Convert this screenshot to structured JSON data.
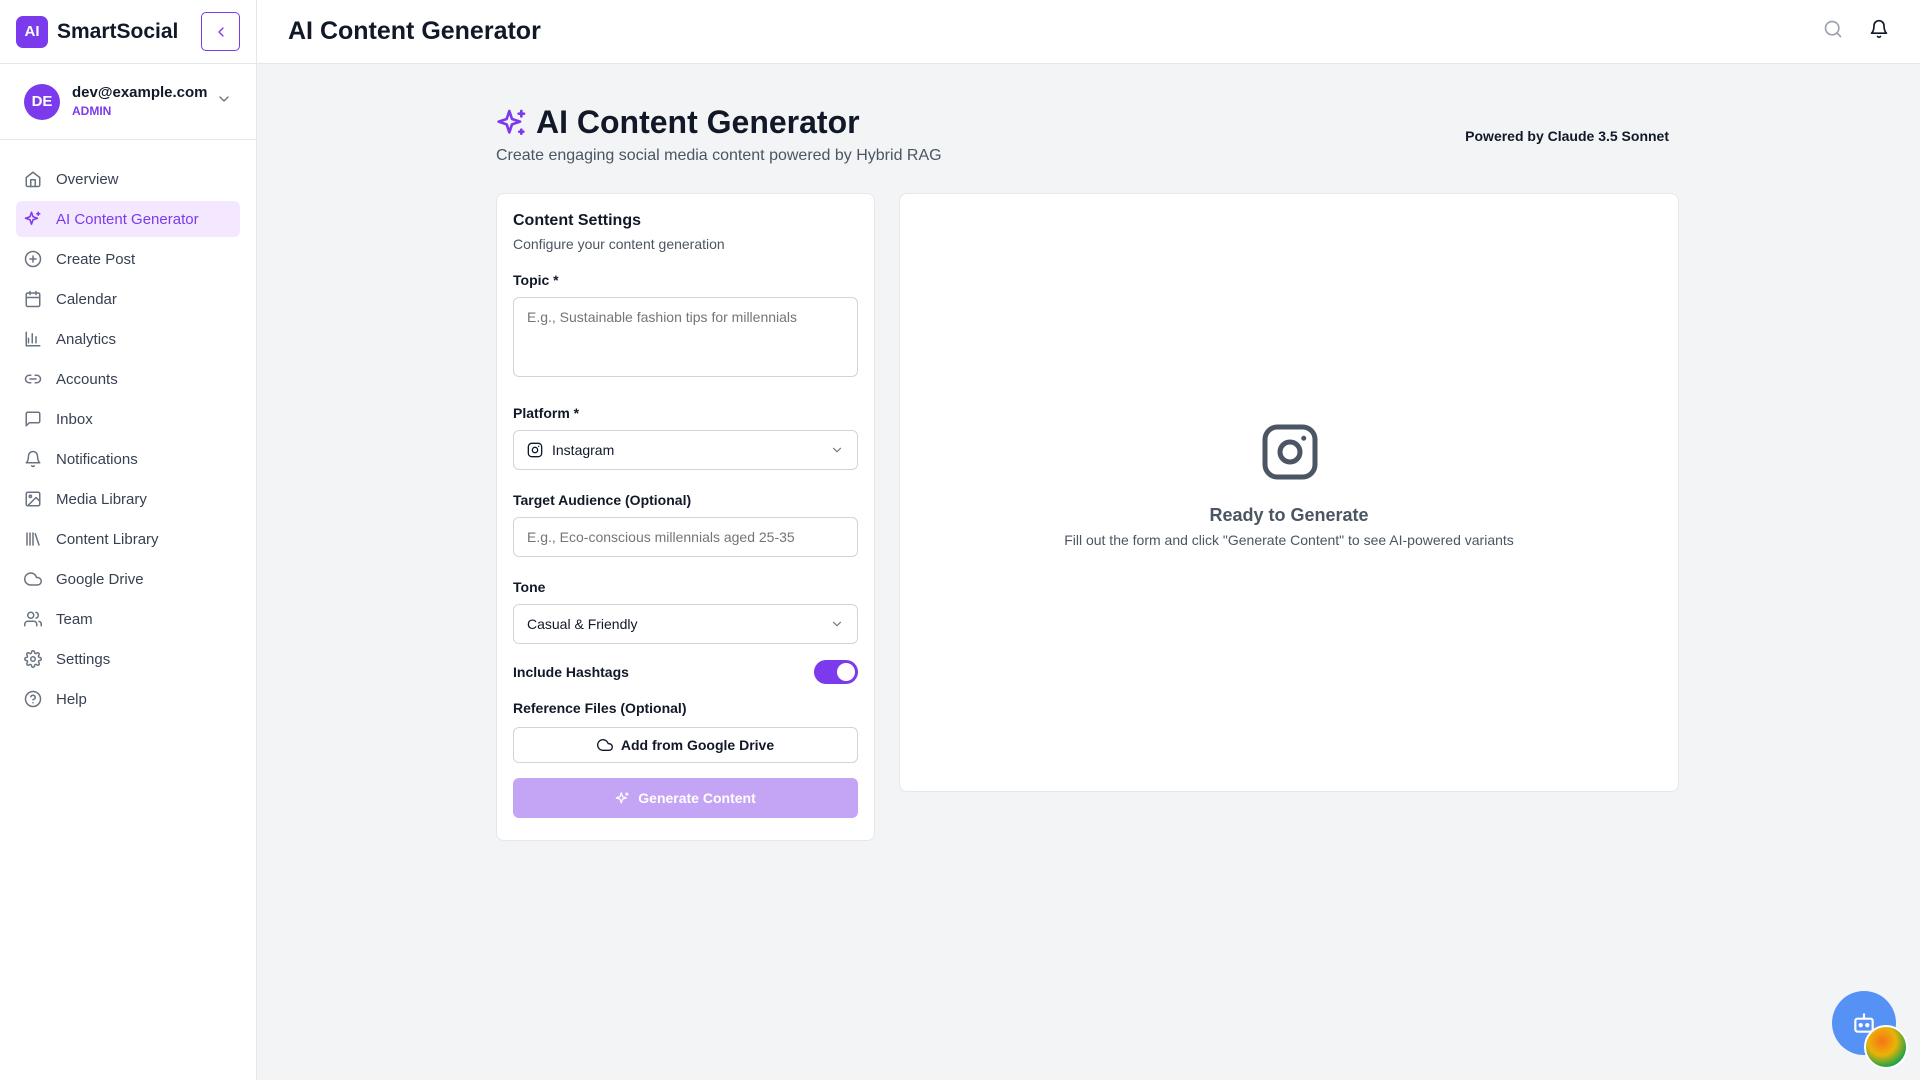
{
  "brand": {
    "logo_text": "AI",
    "name": "SmartSocial"
  },
  "user": {
    "initials": "DE",
    "email": "dev@example.com",
    "role": "ADMIN"
  },
  "sidebar": {
    "items": [
      {
        "label": "Overview",
        "icon": "home-icon",
        "active": false
      },
      {
        "label": "AI Content Generator",
        "icon": "sparkles-icon",
        "active": true
      },
      {
        "label": "Create Post",
        "icon": "plus-circle-icon",
        "active": false
      },
      {
        "label": "Calendar",
        "icon": "calendar-icon",
        "active": false
      },
      {
        "label": "Analytics",
        "icon": "bar-chart-icon",
        "active": false
      },
      {
        "label": "Accounts",
        "icon": "link-icon",
        "active": false
      },
      {
        "label": "Inbox",
        "icon": "message-icon",
        "active": false
      },
      {
        "label": "Notifications",
        "icon": "bell-icon",
        "active": false
      },
      {
        "label": "Media Library",
        "icon": "image-icon",
        "active": false
      },
      {
        "label": "Content Library",
        "icon": "library-icon",
        "active": false
      },
      {
        "label": "Google Drive",
        "icon": "cloud-icon",
        "active": false
      },
      {
        "label": "Team",
        "icon": "users-icon",
        "active": false
      },
      {
        "label": "Settings",
        "icon": "gear-icon",
        "active": false
      },
      {
        "label": "Help",
        "icon": "help-circle-icon",
        "active": false
      }
    ]
  },
  "header": {
    "title": "AI Content Generator"
  },
  "main": {
    "title": "AI Content Generator",
    "subtitle": "Create engaging social media content powered by Hybrid RAG",
    "powered_by": "Powered by Claude 3.5 Sonnet"
  },
  "settings": {
    "title": "Content Settings",
    "subtitle": "Configure your content generation",
    "topic_label": "Topic *",
    "topic_placeholder": "E.g., Sustainable fashion tips for millennials",
    "topic_value": "",
    "platform_label": "Platform *",
    "platform_value": "Instagram",
    "audience_label": "Target Audience (Optional)",
    "audience_placeholder": "E.g., Eco-conscious millennials aged 25-35",
    "audience_value": "",
    "tone_label": "Tone",
    "tone_value": "Casual & Friendly",
    "hashtags_label": "Include Hashtags",
    "hashtags_on": true,
    "reference_label": "Reference Files (Optional)",
    "drive_button": "Add from Google Drive",
    "generate_button": "Generate Content"
  },
  "preview": {
    "title": "Ready to Generate",
    "subtitle": "Fill out the form and click \"Generate Content\" to see AI-powered variants"
  },
  "colors": {
    "accent": "#7c3aed",
    "accent_light": "#f3e8ff",
    "disabled_button": "#c4a4f5",
    "fab": "#3b82f6"
  }
}
